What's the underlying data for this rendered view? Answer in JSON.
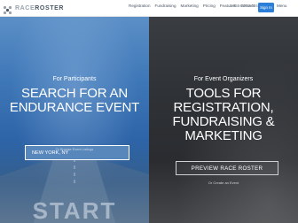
{
  "header": {
    "logo_light": "RACE",
    "logo_bold": "ROSTER",
    "nav": [
      "Registration",
      "Fundraising",
      "Marketing",
      "Pricing",
      "Features",
      "Contact"
    ],
    "phone": "1-855-RRW-5555",
    "signin": "Sign In",
    "menu": "Menu"
  },
  "participants": {
    "eyebrow": "For Participants",
    "headline_1": "SEARCH FOR AN",
    "headline_2": "ENDURANCE EVENT",
    "search_value": "NEW YORK, NY",
    "caption": "Or Browse Event Listings",
    "road_text": "START"
  },
  "organizers": {
    "eyebrow": "For Event Organizers",
    "headline_1": "TOOLS FOR",
    "headline_2": "REGISTRATION,",
    "headline_3": "FUNDRAISING &",
    "headline_4": "MARKETING",
    "button": "PREVIEW RACE ROSTER",
    "create": "Or Create an Event"
  },
  "colors": {
    "accent": "#2c7fd8",
    "left_panel": "#3f78b8",
    "right_panel": "#2e3135"
  }
}
